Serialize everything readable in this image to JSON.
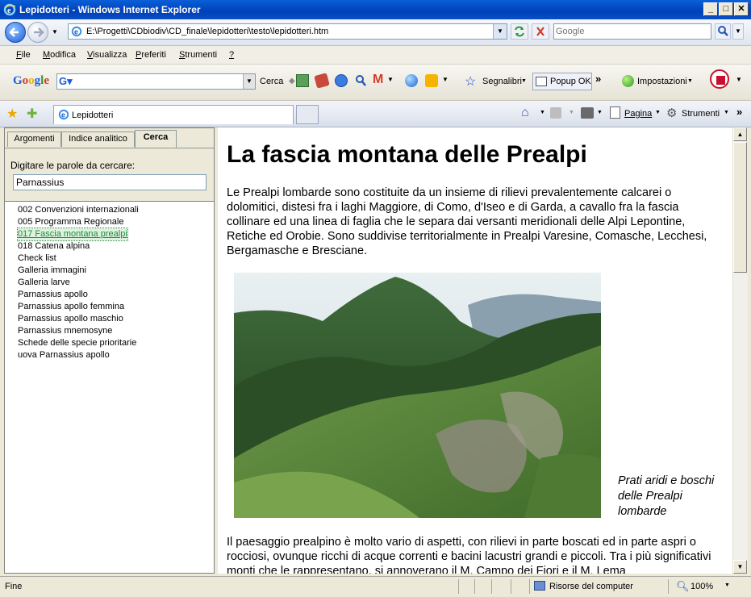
{
  "window": {
    "title": "Lepidotteri - Windows Internet Explorer"
  },
  "address": {
    "url": "E:\\Progetti\\CDbiodiv\\CD_finale\\lepidotteri\\testo\\lepidotteri.htm"
  },
  "search": {
    "placeholder": "Google"
  },
  "menu": [
    {
      "label": "File",
      "key": "F"
    },
    {
      "label": "Modifica",
      "key": "M"
    },
    {
      "label": "Visualizza",
      "key": "V"
    },
    {
      "label": "Preferiti",
      "key": "P"
    },
    {
      "label": "Strumenti",
      "key": "S"
    },
    {
      "label": "?",
      "key": "?"
    }
  ],
  "google_toolbar": {
    "cerca": "Cerca",
    "segnalibri": "Segnalibri",
    "popup": "Popup OK",
    "impostazioni": "Impostazioni"
  },
  "tab": {
    "title": "Lepidotteri"
  },
  "command_bar": {
    "pagina": "Pagina",
    "strumenti": "Strumenti"
  },
  "left_pane": {
    "tabs": [
      "Argomenti",
      "Indice analitico",
      "Cerca"
    ],
    "search_label": "Digitare le parole da cercare:",
    "search_value": "Parnassius",
    "results": [
      "002 Convenzioni internazionali",
      "005 Programma Regionale",
      "017 Fascia montana prealpi",
      "018 Catena alpina",
      "Check list",
      "Galleria immagini",
      "Galleria larve",
      "Parnassius apollo",
      "Parnassius apollo femmina",
      "Parnassius apollo maschio",
      "Parnassius mnemosyne",
      "Schede delle specie prioritarie",
      "uova Parnassius apollo"
    ],
    "selected_index": 2
  },
  "content": {
    "heading": "La fascia montana delle Prealpi",
    "para1": "Le Prealpi lombarde sono costituite da un insieme di rilievi prevalentemente calcarei o dolomitici, distesi fra i laghi Maggiore, di Como, d'Iseo e di Garda, a cavallo fra la fascia collinare ed una linea di faglia che le separa dai versanti meridionali delle Alpi Lepontine, Retiche ed Orobie. Sono suddivise territorialmente in Prealpi Varesine, Comasche, Lecchesi, Bergamasche e Bresciane.",
    "caption": "Prati aridi e boschi delle Prealpi lombarde",
    "para2": "Il paesaggio prealpino è molto vario di aspetti, con rilievi in parte boscati ed in parte aspri o rocciosi, ovunque ricchi di acque correnti e bacini lacustri grandi e piccoli. Tra i più significativi monti che le rappresentano, si annoverano il M. Campo dei Fiori e il M. Lema"
  },
  "status": {
    "left": "Fine",
    "zone": "Risorse del computer",
    "zoom": "100%"
  }
}
